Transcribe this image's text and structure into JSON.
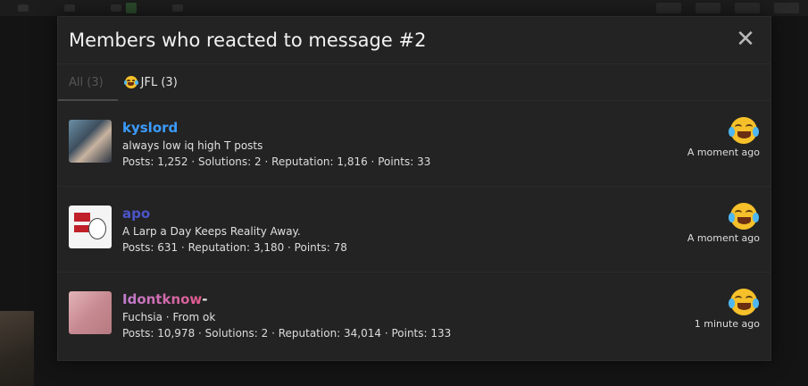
{
  "modal": {
    "title": "Members who reacted to message #2",
    "close_label": "✕"
  },
  "tabs": [
    {
      "label": "All (3)",
      "active": false
    },
    {
      "label": "JFL (3)",
      "active": true,
      "icon": "laughing-crying-emoji-icon"
    }
  ],
  "members": [
    {
      "username": "kyslord",
      "user_title": "always low iq high T posts",
      "stats": "Posts: 1,252 · Solutions: 2 · Reputation: 1,816 · Points: 33",
      "reaction_icon": "laughing-crying-emoji-icon",
      "time": "A moment ago"
    },
    {
      "username": "apo",
      "user_title": "A Larp a Day Keeps Reality Away.",
      "stats": "Posts: 631 · Reputation: 3,180 · Points: 78",
      "reaction_icon": "laughing-crying-emoji-icon",
      "time": "A moment ago"
    },
    {
      "username": "Idontknow",
      "username_suffix": "-",
      "user_title": "Fuchsia · From ok",
      "stats": "Posts: 10,978 · Solutions: 2 · Reputation: 34,014 · Points: 133",
      "reaction_icon": "laughing-crying-emoji-icon",
      "time": "1 minute ago"
    }
  ],
  "colors": {
    "username_1": "#3b9cff",
    "username_2": "#4b55c9",
    "username_3_gradient": [
      "#c07ed0",
      "#e05a8c"
    ],
    "modal_bg": "#232323"
  }
}
